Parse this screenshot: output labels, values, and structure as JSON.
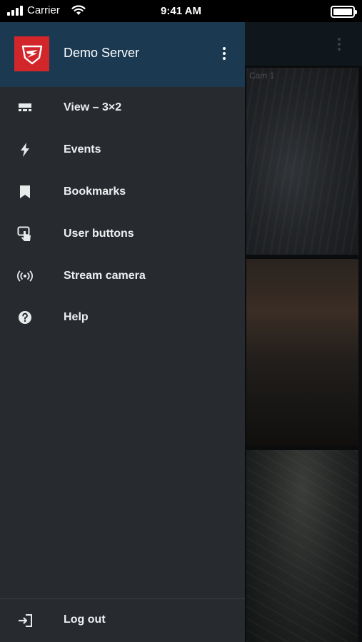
{
  "status_bar": {
    "carrier": "Carrier",
    "time": "9:41 AM",
    "icons": [
      "signal-bars-icon",
      "wifi-icon",
      "battery-icon"
    ]
  },
  "drawer": {
    "server_name": "Demo Server",
    "logo_icon": "server-logo-icon",
    "more_icon": "more-vertical-icon",
    "items": [
      {
        "label": "View – 3×2",
        "icon": "grid-view-icon"
      },
      {
        "label": "Events",
        "icon": "lightning-icon"
      },
      {
        "label": "Bookmarks",
        "icon": "bookmark-icon"
      },
      {
        "label": "User buttons",
        "icon": "touch-button-icon"
      },
      {
        "label": "Stream camera",
        "icon": "broadcast-icon"
      },
      {
        "label": "Help",
        "icon": "help-icon"
      }
    ],
    "footer": {
      "label": "Log out",
      "icon": "logout-icon"
    }
  },
  "background": {
    "camera_label": "Cam 1"
  },
  "colors": {
    "drawer_bg": "#272b2f",
    "header_bg": "#1b3a52",
    "logo_red": "#d3262b"
  }
}
